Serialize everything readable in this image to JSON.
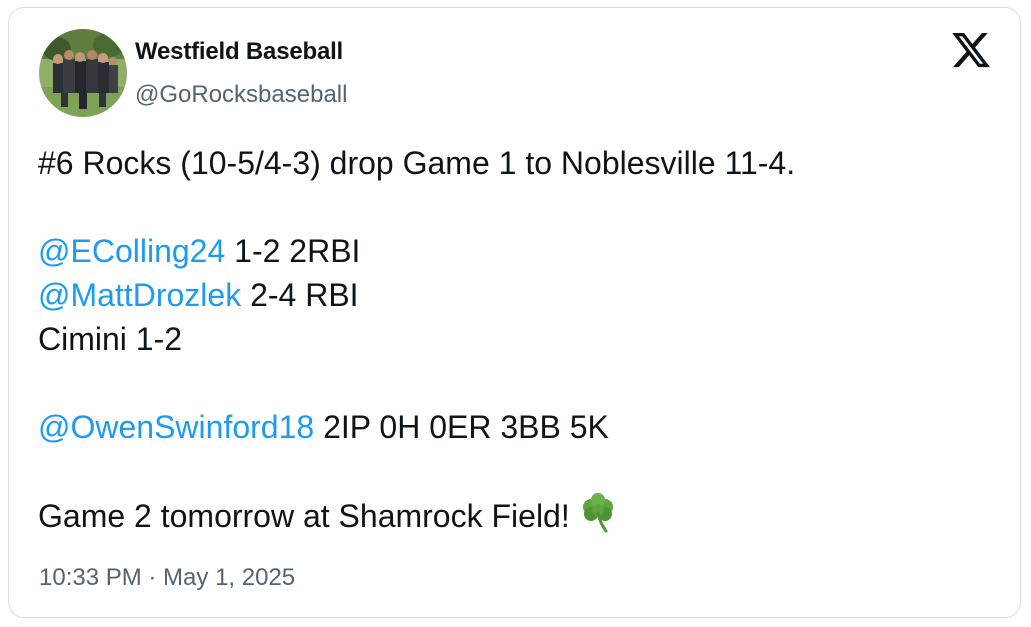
{
  "author": {
    "display_name": "Westfield Baseball",
    "handle": "@GoRocksbaseball",
    "avatar_icon": "team-photo-avatar"
  },
  "brand": {
    "logo_icon": "x-logo-icon",
    "text_color": "#0f1419",
    "link_color": "#1d9bf0",
    "muted_color": "#536471"
  },
  "tweet": {
    "line1": "#6 Rocks (10-5/4-3) drop Game 1 to Noblesville 11-4.",
    "mention1": "@EColling24",
    "stat1": " 1-2 2RBI",
    "mention2": "@MattDrozlek",
    "stat2": " 2-4 RBI",
    "line4": "Cimini 1-2",
    "mention3": "@OwenSwinford18",
    "stat3": " 2IP 0H 0ER 3BB 5K",
    "line6": "Game 2 tomorrow at Shamrock Field!",
    "emoji_icon": "shamrock-icon"
  },
  "timestamp": "10:33 PM · May 1, 2025"
}
